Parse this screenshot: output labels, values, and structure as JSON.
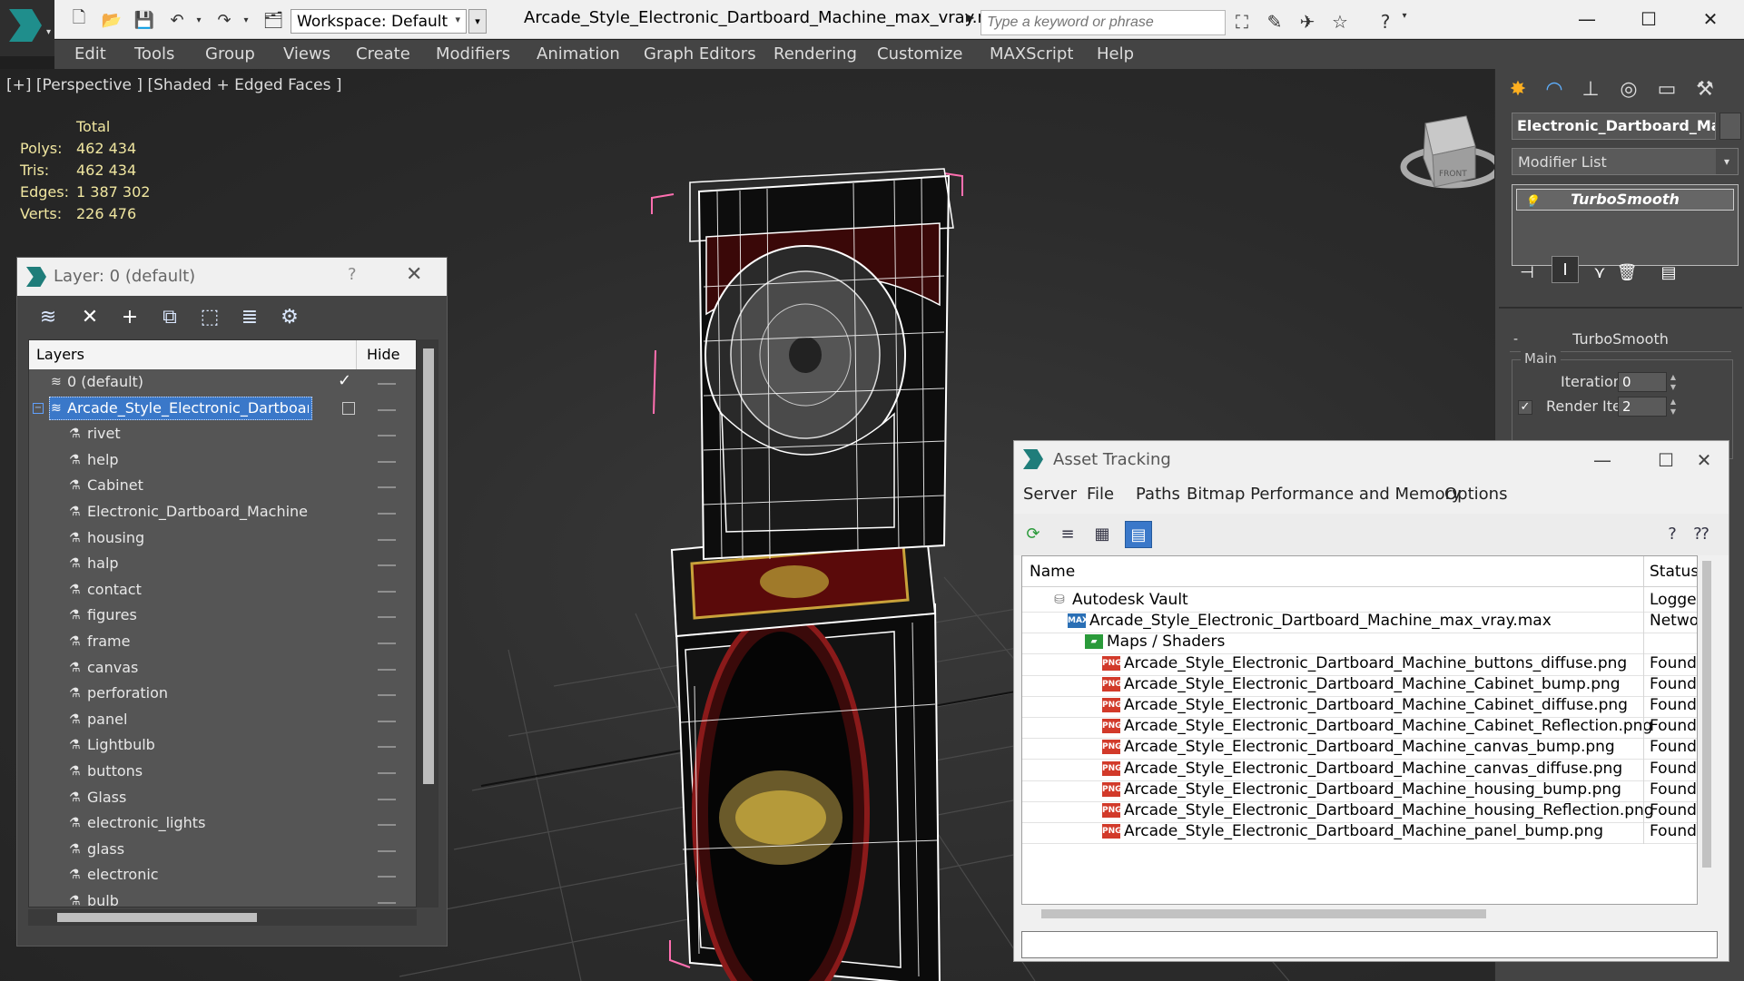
{
  "titlebar": {
    "workspace_label": "Workspace: Default",
    "document_title": "Arcade_Style_Electronic_Dartboard_Machine_max_vray.max",
    "search_placeholder": "Type a keyword or phrase"
  },
  "menu": [
    "Edit",
    "Tools",
    "Group",
    "Views",
    "Create",
    "Modifiers",
    "Animation",
    "Graph Editors",
    "Rendering",
    "Customize",
    "MAXScript",
    "Help"
  ],
  "viewport": {
    "label": "[+] [Perspective ] [Shaded + Edged Faces ]",
    "stats": {
      "total_label": "Total",
      "rows": [
        {
          "label": "Polys:",
          "value": "462 434"
        },
        {
          "label": "Tris:",
          "value": "462 434"
        },
        {
          "label": "Edges:",
          "value": "1 387 302"
        },
        {
          "label": "Verts:",
          "value": "226 476"
        }
      ]
    },
    "viewcube_label": "FRONT"
  },
  "layer_panel": {
    "title": "Layer: 0 (default)",
    "help": "?",
    "col_layers": "Layers",
    "col_hide": "Hide",
    "default_layer": "0 (default)",
    "selected_layer": "Arcade_Style_Electronic_Dartboard_Machine",
    "objects": [
      "rivet",
      "help",
      "Cabinet",
      "Electronic_Dartboard_Machine",
      "housing",
      "halp",
      "contact",
      "figures",
      "frame",
      "canvas",
      "perforation",
      "panel",
      "Lightbulb",
      "buttons",
      "Glass",
      "electronic_lights",
      "glass",
      "electronic",
      "bulb"
    ]
  },
  "command_panel": {
    "object_name": "Electronic_Dartboard_Machine",
    "modifier_list": "Modifier List",
    "modifier": "TurboSmooth",
    "rollout_title": "TurboSmooth",
    "group_main": "Main",
    "iterations_label": "Iterations:",
    "iterations_value": "0",
    "render_iters_label": "Render Iters:",
    "render_iters_value": "2"
  },
  "asset_tracking": {
    "title": "Asset Tracking",
    "menu": [
      "Server",
      "File",
      "Paths",
      "Bitmap Performance and Memory",
      "Options"
    ],
    "col_name": "Name",
    "col_status": "Status",
    "rows": [
      {
        "name": "Autodesk Vault",
        "status": "Logged",
        "indent": 1,
        "icon": "vault"
      },
      {
        "name": "Arcade_Style_Electronic_Dartboard_Machine_max_vray.max",
        "status": "Networ",
        "indent": 2,
        "icon": "max"
      },
      {
        "name": "Maps / Shaders",
        "status": "",
        "indent": 3,
        "icon": "maps"
      },
      {
        "name": "Arcade_Style_Electronic_Dartboard_Machine_buttons_diffuse.png",
        "status": "Found",
        "indent": 4,
        "icon": "png"
      },
      {
        "name": "Arcade_Style_Electronic_Dartboard_Machine_Cabinet_bump.png",
        "status": "Found",
        "indent": 4,
        "icon": "png"
      },
      {
        "name": "Arcade_Style_Electronic_Dartboard_Machine_Cabinet_diffuse.png",
        "status": "Found",
        "indent": 4,
        "icon": "png"
      },
      {
        "name": "Arcade_Style_Electronic_Dartboard_Machine_Cabinet_Reflection.png",
        "status": "Found",
        "indent": 4,
        "icon": "png"
      },
      {
        "name": "Arcade_Style_Electronic_Dartboard_Machine_canvas_bump.png",
        "status": "Found",
        "indent": 4,
        "icon": "png"
      },
      {
        "name": "Arcade_Style_Electronic_Dartboard_Machine_canvas_diffuse.png",
        "status": "Found",
        "indent": 4,
        "icon": "png"
      },
      {
        "name": "Arcade_Style_Electronic_Dartboard_Machine_housing_bump.png",
        "status": "Found",
        "indent": 4,
        "icon": "png"
      },
      {
        "name": "Arcade_Style_Electronic_Dartboard_Machine_housing_Reflection.png",
        "status": "Found",
        "indent": 4,
        "icon": "png"
      },
      {
        "name": "Arcade_Style_Electronic_Dartboard_Machine_panel_bump.png",
        "status": "Found",
        "indent": 4,
        "icon": "png"
      }
    ]
  },
  "colors": {
    "accent": "#1f8e8c",
    "selection": "#3a78c9",
    "stats_text": "#f0e6a0",
    "wire": "#ffffff",
    "bbox": "#ff6fb0"
  }
}
